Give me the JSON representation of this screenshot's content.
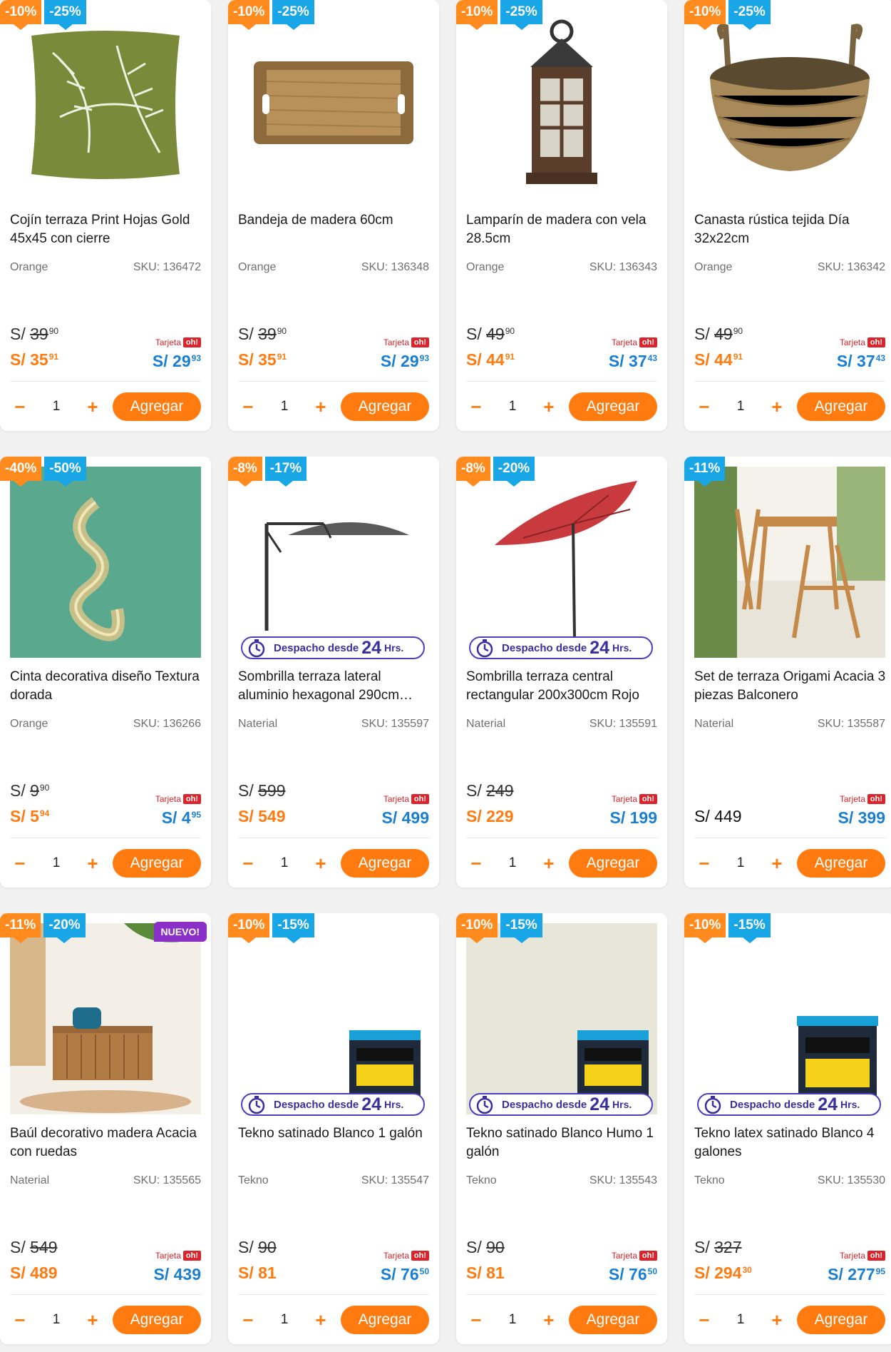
{
  "colors": {
    "discount_orange": "#ff8a1e",
    "discount_blue": "#18a6e6",
    "price_orange": "#ff7b10",
    "card_price_blue": "#1b7fd1",
    "tarjeta_red": "#e0222a",
    "despacho_purple": "#4b3fbf",
    "nuevo_purple": "#8b2fc9"
  },
  "common": {
    "add_label": "Agregar",
    "qty": "1",
    "minus": "−",
    "plus": "+",
    "currency": "S/",
    "tarjeta": "Tarjeta",
    "oh": "oh!",
    "despacho_text": "Despacho desde",
    "despacho_num": "24",
    "despacho_hrs": "Hrs.",
    "nuevo": "NUEVO!"
  },
  "products": [
    {
      "name": "Cojín terraza Print Hojas Gold 45x45 con cierre",
      "brand": "Orange",
      "sku": "SKU: 136472",
      "badges": [
        "-10%",
        "-25%"
      ],
      "old": "39",
      "old_dec": "90",
      "now": "35",
      "now_dec": "91",
      "card": "29",
      "card_dec": "93",
      "img": "pillow-image",
      "despacho": false,
      "nuevo": false
    },
    {
      "name": "Bandeja de madera 60cm",
      "brand": "Orange",
      "sku": "SKU: 136348",
      "badges": [
        "-10%",
        "-25%"
      ],
      "old": "39",
      "old_dec": "90",
      "now": "35",
      "now_dec": "91",
      "card": "29",
      "card_dec": "93",
      "img": "tray-image",
      "despacho": false,
      "nuevo": false
    },
    {
      "name": "Lamparín de madera con vela 28.5cm",
      "brand": "Orange",
      "sku": "SKU: 136343",
      "badges": [
        "-10%",
        "-25%"
      ],
      "old": "49",
      "old_dec": "90",
      "now": "44",
      "now_dec": "91",
      "card": "37",
      "card_dec": "43",
      "img": "lantern-image",
      "despacho": false,
      "nuevo": false
    },
    {
      "name": "Canasta rústica tejida Día 32x22cm",
      "brand": "Orange",
      "sku": "SKU: 136342",
      "badges": [
        "-10%",
        "-25%"
      ],
      "old": "49",
      "old_dec": "90",
      "now": "44",
      "now_dec": "91",
      "card": "37",
      "card_dec": "43",
      "img": "basket-image",
      "despacho": false,
      "nuevo": false
    },
    {
      "name": "Cinta decorativa diseño Textura dorada",
      "brand": "Orange",
      "sku": "SKU: 136266",
      "badges": [
        "-40%",
        "-50%"
      ],
      "old": "9",
      "old_dec": "90",
      "now": "5",
      "now_dec": "94",
      "card": "4",
      "card_dec": "95",
      "img": "ribbon-image",
      "despacho": false,
      "nuevo": false
    },
    {
      "name": "Sombrilla terraza lateral aluminio hexagonal 290cm…",
      "brand": "Naterial",
      "sku": "SKU: 135597",
      "badges": [
        "-8%",
        "-17%"
      ],
      "old": "599",
      "old_dec": "",
      "now": "549",
      "now_dec": "",
      "card": "499",
      "card_dec": "",
      "img": "umbrella-gray-image",
      "despacho": true,
      "nuevo": false
    },
    {
      "name": "Sombrilla terraza central rectangular 200x300cm Rojo",
      "brand": "Naterial",
      "sku": "SKU: 135591",
      "badges": [
        "-8%",
        "-20%"
      ],
      "old": "249",
      "old_dec": "",
      "now": "229",
      "now_dec": "",
      "card": "199",
      "card_dec": "",
      "img": "umbrella-red-image",
      "despacho": true,
      "nuevo": false
    },
    {
      "name": "Set de terraza Origami Acacia 3 piezas Balconero",
      "brand": "Naterial",
      "sku": "SKU: 135587",
      "badges": [
        "-11%"
      ],
      "old": "",
      "old_dec": "",
      "now": "449",
      "now_dec": "",
      "card": "399",
      "card_dec": "",
      "img": "terrace-set-image",
      "despacho": false,
      "nuevo": false,
      "now_black": true
    },
    {
      "name": "Baúl decorativo madera Acacia con ruedas",
      "brand": "Naterial",
      "sku": "SKU: 135565",
      "badges": [
        "-11%",
        "-20%"
      ],
      "old": "549",
      "old_dec": "",
      "now": "489",
      "now_dec": "",
      "card": "439",
      "card_dec": "",
      "img": "chest-image",
      "despacho": false,
      "nuevo": true
    },
    {
      "name": "Tekno satinado Blanco 1 galón",
      "brand": "Tekno",
      "sku": "SKU: 135547",
      "badges": [
        "-10%",
        "-15%"
      ],
      "old": "90",
      "old_dec": "",
      "now": "81",
      "now_dec": "",
      "card": "76",
      "card_dec": "50",
      "img": "paint-can-image",
      "despacho": true,
      "nuevo": false
    },
    {
      "name": "Tekno satinado Blanco Humo 1 galón",
      "brand": "Tekno",
      "sku": "SKU: 135543",
      "badges": [
        "-10%",
        "-15%"
      ],
      "old": "90",
      "old_dec": "",
      "now": "81",
      "now_dec": "",
      "card": "76",
      "card_dec": "50",
      "img": "paint-can-beige-image",
      "despacho": true,
      "nuevo": false
    },
    {
      "name": "Tekno latex satinado Blanco 4 galones",
      "brand": "Tekno",
      "sku": "SKU: 135530",
      "badges": [
        "-10%",
        "-15%"
      ],
      "old": "327",
      "old_dec": "",
      "now": "294",
      "now_dec": "30",
      "card": "277",
      "card_dec": "95",
      "img": "paint-bucket-image",
      "despacho": true,
      "nuevo": false
    }
  ]
}
